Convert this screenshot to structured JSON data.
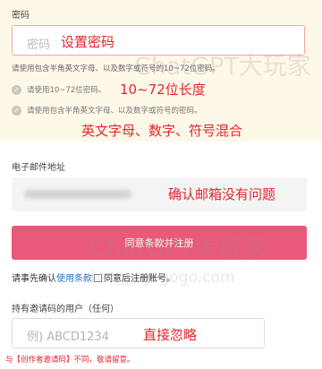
{
  "password": {
    "label": "密码",
    "placeholder": "密码",
    "annotation": "设置密码",
    "help_text": "请使用包含半角英文字母、以及数字或符号的10~72位密码。",
    "checks": [
      {
        "icon": "checkmark-icon",
        "text": "请使用10~72位密码。",
        "annotation": "10~72位长度"
      },
      {
        "icon": "checkmark-icon",
        "text": "请使用包含半角英文字母、以及数字或符号的密码。",
        "annotation": "英文字母、数字、符号混合"
      }
    ]
  },
  "email": {
    "label": "电子邮件地址",
    "annotation": "确认邮箱没有问题"
  },
  "submit_button": "同意条款并注册",
  "terms": {
    "prefix": "请事先确认",
    "link": "使用条款",
    "suffix": "同意后注册账号。"
  },
  "invite": {
    "label": "持有邀请码的用户（任何）",
    "placeholder": "例) ABCD1234",
    "annotation": "直接忽略"
  },
  "warning": "与【创作者邀请码】不同，敬请留意。",
  "watermarks": [
    "ChatGPT大玩家",
    "ChatGPT大玩家",
    "chatgptgogogo.com"
  ],
  "colors": {
    "accent_red": "#e5262d",
    "submit_pink": "#e8597a",
    "panel_cream": "#fdf8e8",
    "link_blue": "#2a6fb8"
  }
}
